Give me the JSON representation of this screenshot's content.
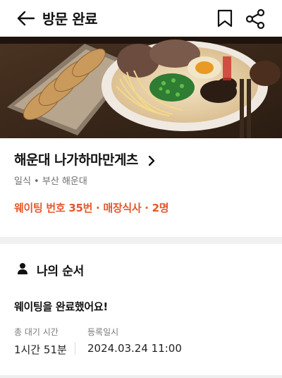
{
  "header": {
    "title": "방문 완료",
    "icons": {
      "back": "back-arrow-icon",
      "bookmark": "bookmark-icon",
      "share": "share-icon"
    }
  },
  "hero_image": {
    "subject": "ramen bowl and gyoza dish"
  },
  "store": {
    "name": "해운대 나가하마만게츠",
    "category": "일식 • 부산 해운대",
    "waiting_info": "웨이팅 번호 35번 · 매장식사 · 2명",
    "accent_color": "#e4572a"
  },
  "my_order": {
    "section_title": "나의 순서",
    "status": "웨이팅을 완료했어요!",
    "total_wait_label": "총 대기 시간",
    "total_wait_value": "1시간 51분",
    "registered_label": "등록일시",
    "registered_value": "2024.03.24 11:00"
  }
}
